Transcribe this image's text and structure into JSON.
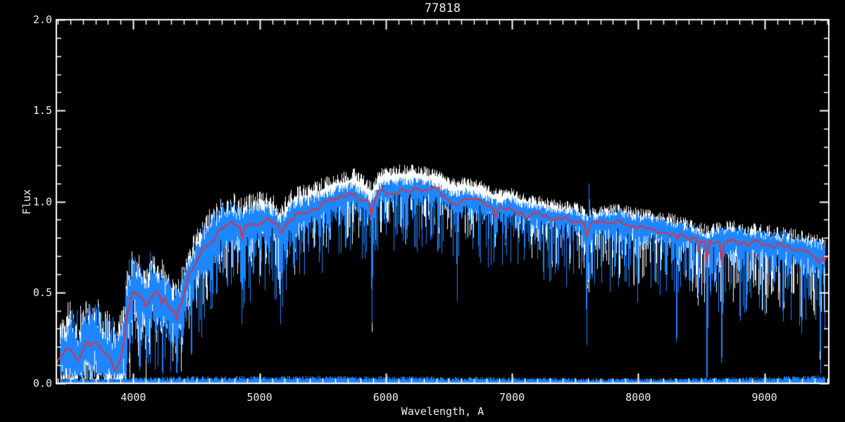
{
  "window": {
    "background": "#000000"
  },
  "chart_data": {
    "type": "line",
    "title": "77818",
    "xlabel": "Wavelength, A",
    "ylabel": "Flux",
    "xlim": [
      3390,
      9510
    ],
    "ylim": [
      0,
      2
    ],
    "x_major_ticks": [
      {
        "value": 4000,
        "label": "4000"
      },
      {
        "value": 5000,
        "label": "5000"
      },
      {
        "value": 6000,
        "label": "6000"
      },
      {
        "value": 7000,
        "label": "7000"
      },
      {
        "value": 8000,
        "label": "8000"
      },
      {
        "value": 9000,
        "label": "9000"
      }
    ],
    "x_minor_step": 100,
    "y_major_ticks": [
      {
        "value": 0.0,
        "label": "0.0"
      },
      {
        "value": 0.5,
        "label": "0.5"
      },
      {
        "value": 1.0,
        "label": "1.0"
      },
      {
        "value": 1.5,
        "label": "1.5"
      },
      {
        "value": 2.0,
        "label": "2.0"
      }
    ],
    "y_minor_step": 0.1,
    "grid": false,
    "legend": null,
    "background": "#000000",
    "axis_color": "#ffffff",
    "tick_label_color": "#ededed",
    "seed": 77818,
    "continuum_anchors": [
      [
        3390,
        0.1
      ],
      [
        3450,
        0.17
      ],
      [
        3500,
        0.19
      ],
      [
        3560,
        0.11
      ],
      [
        3620,
        0.25
      ],
      [
        3660,
        0.22
      ],
      [
        3720,
        0.23
      ],
      [
        3790,
        0.16
      ],
      [
        3860,
        0.08
      ],
      [
        3910,
        0.18
      ],
      [
        3950,
        0.42
      ],
      [
        4000,
        0.52
      ],
      [
        4060,
        0.47
      ],
      [
        4100,
        0.44
      ],
      [
        4170,
        0.5
      ],
      [
        4230,
        0.47
      ],
      [
        4290,
        0.4
      ],
      [
        4350,
        0.38
      ],
      [
        4420,
        0.55
      ],
      [
        4480,
        0.64
      ],
      [
        4550,
        0.74
      ],
      [
        4620,
        0.8
      ],
      [
        4700,
        0.86
      ],
      [
        4780,
        0.89
      ],
      [
        4840,
        0.85
      ],
      [
        4900,
        0.87
      ],
      [
        4950,
        0.89
      ],
      [
        5060,
        0.91
      ],
      [
        5170,
        0.84
      ],
      [
        5230,
        0.91
      ],
      [
        5300,
        0.94
      ],
      [
        5400,
        0.95
      ],
      [
        5500,
        0.99
      ],
      [
        5600,
        1.01
      ],
      [
        5750,
        1.04
      ],
      [
        5880,
        0.97
      ],
      [
        5960,
        1.05
      ],
      [
        6100,
        1.07
      ],
      [
        6250,
        1.07
      ],
      [
        6400,
        1.05
      ],
      [
        6550,
        1.0
      ],
      [
        6620,
        1.02
      ],
      [
        6750,
        1.0
      ],
      [
        6870,
        0.96
      ],
      [
        7000,
        0.97
      ],
      [
        7100,
        0.94
      ],
      [
        7200,
        0.93
      ],
      [
        7350,
        0.91
      ],
      [
        7500,
        0.9
      ],
      [
        7600,
        0.86
      ],
      [
        7700,
        0.89
      ],
      [
        7850,
        0.89
      ],
      [
        8000,
        0.87
      ],
      [
        8150,
        0.85
      ],
      [
        8300,
        0.83
      ],
      [
        8450,
        0.8
      ],
      [
        8550,
        0.77
      ],
      [
        8650,
        0.79
      ],
      [
        8800,
        0.79
      ],
      [
        8950,
        0.77
      ],
      [
        9100,
        0.76
      ],
      [
        9250,
        0.74
      ],
      [
        9400,
        0.71
      ],
      [
        9510,
        0.7
      ]
    ],
    "noise_amp_anchors": [
      [
        3400,
        0.1
      ],
      [
        3900,
        0.1
      ],
      [
        4200,
        0.09
      ],
      [
        4700,
        0.08
      ],
      [
        5300,
        0.055
      ],
      [
        6000,
        0.04
      ],
      [
        6600,
        0.035
      ],
      [
        7000,
        0.035
      ],
      [
        8000,
        0.042
      ],
      [
        9000,
        0.05
      ],
      [
        9500,
        0.055
      ]
    ],
    "spike_depth_anchors": [
      [
        3400,
        0.28
      ],
      [
        4300,
        0.38
      ],
      [
        5200,
        0.34
      ],
      [
        6000,
        0.3
      ],
      [
        7000,
        0.3
      ],
      [
        8200,
        0.38
      ],
      [
        9500,
        0.4
      ]
    ],
    "absorption_lines": [
      {
        "wavelength": 3933,
        "depth": 0.3,
        "width": 12
      },
      {
        "wavelength": 3968,
        "depth": 0.26,
        "width": 12
      },
      {
        "wavelength": 4101,
        "depth": 0.24,
        "width": 12
      },
      {
        "wavelength": 4226,
        "depth": 0.18,
        "width": 10
      },
      {
        "wavelength": 4340,
        "depth": 0.26,
        "width": 12
      },
      {
        "wavelength": 4383,
        "depth": 0.16,
        "width": 10
      },
      {
        "wavelength": 4861,
        "depth": 0.28,
        "width": 12
      },
      {
        "wavelength": 5172,
        "depth": 0.22,
        "width": 16
      },
      {
        "wavelength": 5270,
        "depth": 0.15,
        "width": 12
      },
      {
        "wavelength": 5890,
        "depth": 0.62,
        "width": 12
      },
      {
        "wavelength": 6280,
        "depth": 0.1,
        "width": 10
      },
      {
        "wavelength": 6563,
        "depth": 0.48,
        "width": 10
      },
      {
        "wavelength": 6870,
        "depth": 0.14,
        "width": 16
      },
      {
        "wavelength": 7180,
        "depth": 0.12,
        "width": 14
      },
      {
        "wavelength": 7594,
        "depth": 0.34,
        "width": 20
      },
      {
        "wavelength": 8304,
        "depth": 0.42,
        "width": 10
      },
      {
        "wavelength": 8476,
        "depth": 0.28,
        "width": 10
      },
      {
        "wavelength": 8542,
        "depth": 0.58,
        "width": 10
      },
      {
        "wavelength": 8662,
        "depth": 0.6,
        "width": 10
      },
      {
        "wavelength": 8806,
        "depth": 0.44,
        "width": 10
      },
      {
        "wavelength": 9440,
        "depth": 0.62,
        "width": 10
      },
      {
        "wavelength": 9490,
        "depth": 0.7,
        "width": 8
      }
    ],
    "emission_spikes": [
      {
        "wavelength": 7610,
        "height": 0.26,
        "width": 7
      }
    ],
    "series": [
      {
        "name": "observed-spectrum-white",
        "type": "noisy-line",
        "color": "#ffffff",
        "offset_anchors": [
          [
            3400,
            0.01
          ],
          [
            4500,
            0.02
          ],
          [
            5200,
            0.04
          ],
          [
            5800,
            0.06
          ],
          [
            6300,
            0.06
          ],
          [
            6800,
            0.05
          ],
          [
            7300,
            0.03
          ],
          [
            7800,
            0.02
          ],
          [
            8400,
            0.015
          ],
          [
            9500,
            0.01
          ]
        ]
      },
      {
        "name": "observed-spectrum-blue",
        "type": "noisy-line",
        "color": "#1e86ff"
      },
      {
        "name": "model-fit-red",
        "type": "line",
        "color": "#e03040"
      },
      {
        "name": "error-spectrum",
        "type": "noisy-line",
        "color": "#1e86ff",
        "anchors": [
          [
            3400,
            0.018
          ],
          [
            4300,
            0.028
          ],
          [
            5500,
            0.032
          ],
          [
            6700,
            0.026
          ],
          [
            8000,
            0.02
          ],
          [
            8900,
            0.026
          ],
          [
            9500,
            0.034
          ]
        ]
      }
    ]
  }
}
